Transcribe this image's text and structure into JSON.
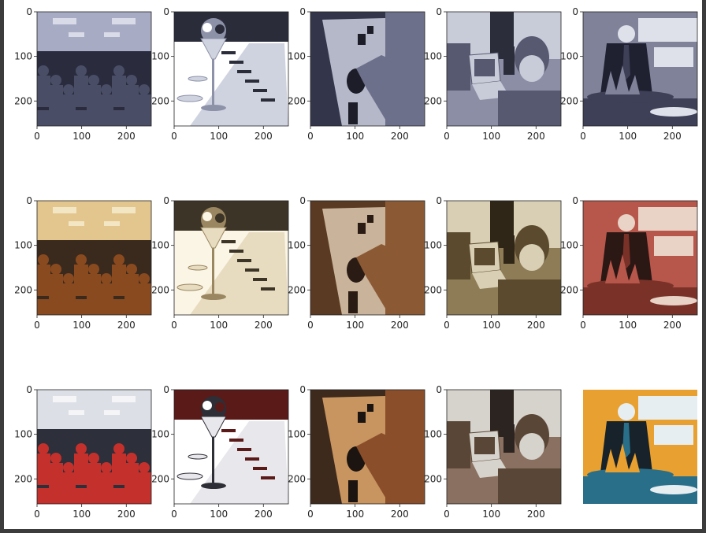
{
  "chart_data": {
    "type": "image_grid",
    "rows": 3,
    "cols": 5,
    "x_ticks": [
      "0",
      "100",
      "200"
    ],
    "y_ticks": [
      "0",
      "100",
      "200"
    ],
    "xlim": [
      0,
      256
    ],
    "ylim": [
      256,
      0
    ],
    "panels": [
      {
        "row": 0,
        "col": 0,
        "scene": "crowded-store",
        "palette": [
          "#4a4d66",
          "#a8abc4",
          "#2a2c3e",
          "#d9dbe8"
        ]
      },
      {
        "row": 0,
        "col": 1,
        "scene": "banquet-table-vase",
        "palette": [
          "#2a2c3a",
          "#cfd3e0",
          "#8d92a8",
          "#ffffff"
        ]
      },
      {
        "row": 0,
        "col": 2,
        "scene": "person-through-table",
        "palette": [
          "#33354a",
          "#b5b8c9",
          "#6d708a",
          "#1c1d28"
        ]
      },
      {
        "row": 0,
        "col": 3,
        "scene": "person-at-laptop",
        "palette": [
          "#56596f",
          "#c8cbd8",
          "#8b8ea4",
          "#2b2d3a"
        ]
      },
      {
        "row": 0,
        "col": 4,
        "scene": "chef-with-grill",
        "palette": [
          "#3d4056",
          "#dfe1ea",
          "#7f8298",
          "#1f2030"
        ]
      },
      {
        "row": 1,
        "col": 0,
        "scene": "crowded-store",
        "palette": [
          "#8a4a1f",
          "#e3c68e",
          "#3a2a1e",
          "#f2e6c4"
        ]
      },
      {
        "row": 1,
        "col": 1,
        "scene": "banquet-table-vase",
        "palette": [
          "#3c3426",
          "#e7dcc0",
          "#9a8660",
          "#fbf5e6"
        ]
      },
      {
        "row": 1,
        "col": 2,
        "scene": "person-through-table",
        "palette": [
          "#5a3a22",
          "#c9b39a",
          "#8b5a35",
          "#2a1c14"
        ]
      },
      {
        "row": 1,
        "col": 3,
        "scene": "person-at-laptop",
        "palette": [
          "#5b4a2e",
          "#d8cfb4",
          "#8e7c56",
          "#2f2618"
        ]
      },
      {
        "row": 1,
        "col": 4,
        "scene": "chef-with-grill",
        "palette": [
          "#7a3228",
          "#e9d2c6",
          "#b7564a",
          "#2b1714"
        ]
      },
      {
        "row": 2,
        "col": 0,
        "scene": "crowded-store",
        "palette": [
          "#c4302b",
          "#dcdfe6",
          "#2d2f3a",
          "#f5f5f8"
        ]
      },
      {
        "row": 2,
        "col": 1,
        "scene": "banquet-table-vase",
        "palette": [
          "#5a1a18",
          "#e8e8ec",
          "#2e2e36",
          "#ffffff"
        ]
      },
      {
        "row": 2,
        "col": 2,
        "scene": "person-through-table",
        "palette": [
          "#3d2a1c",
          "#c89560",
          "#8a4f2a",
          "#1b1410"
        ]
      },
      {
        "row": 2,
        "col": 3,
        "scene": "person-at-laptop",
        "palette": [
          "#5a4636",
          "#d6d2cc",
          "#8a7060",
          "#2c2420"
        ]
      },
      {
        "row": 2,
        "col": 4,
        "scene": "chef-with-grill",
        "palette": [
          "#2a6f8a",
          "#e6eef2",
          "#e8a030",
          "#17222a"
        ]
      }
    ]
  }
}
